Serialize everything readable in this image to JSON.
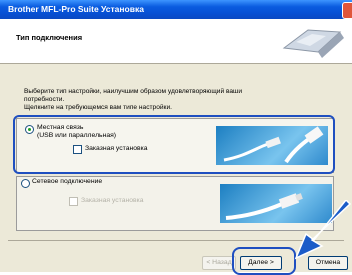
{
  "window": {
    "title": "Brother MFL-Pro Suite Установка"
  },
  "header": {
    "title": "Тип подключения"
  },
  "description": {
    "line1": "Выберите тип настройки, наилучшим образом удовлетворяющий ваши",
    "line2": "потребности.",
    "line3": "Щелкните на требующемся вам типе настройки."
  },
  "options": {
    "local": {
      "label": "Местная связь",
      "sublabel": "(USB или параллельная)",
      "selected": true,
      "custom_label": "Заказная установка"
    },
    "network": {
      "label": "Сетевое подключение",
      "selected": false,
      "custom_label": "Заказная установка"
    }
  },
  "buttons": {
    "back": "< Назад",
    "next": "Далее >",
    "cancel": "Отмена"
  },
  "colors": {
    "highlight": "#1f4fc0",
    "titlebar": "#0a5ce0"
  }
}
